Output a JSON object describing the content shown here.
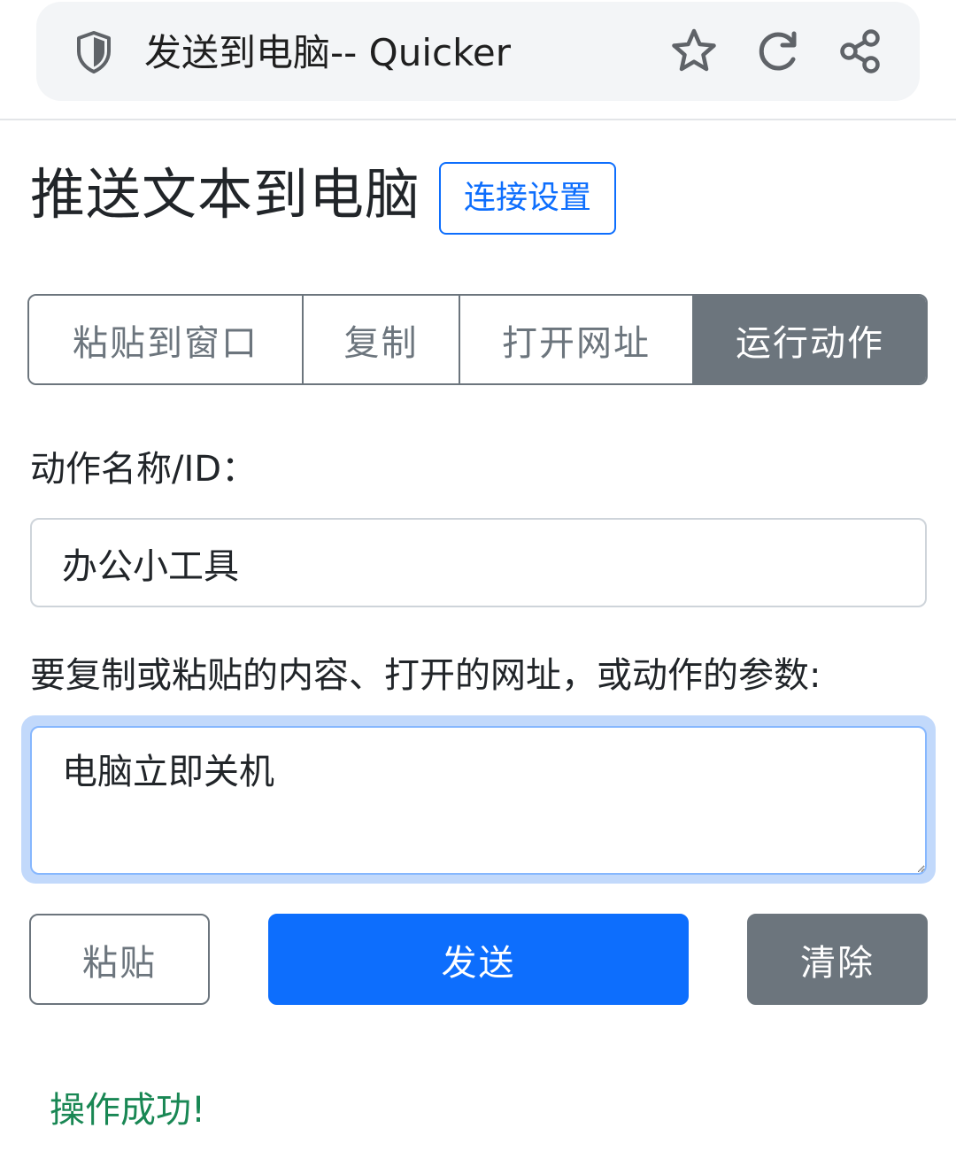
{
  "browser": {
    "page_title": "发送到电脑-- Quicker",
    "icons": [
      "shield-icon",
      "star-icon",
      "refresh-icon",
      "share-icon"
    ]
  },
  "header": {
    "title": "推送文本到电脑",
    "settings_label": "连接设置"
  },
  "modes": {
    "items": [
      {
        "label": "粘贴到窗口",
        "active": false
      },
      {
        "label": "复制",
        "active": false
      },
      {
        "label": "打开网址",
        "active": false
      },
      {
        "label": "运行动作",
        "active": true
      }
    ]
  },
  "form": {
    "action_label": "动作名称/ID：",
    "action_value": "办公小工具",
    "content_label": "要复制或粘贴的内容、打开的网址，或动作的参数:",
    "content_value": "电脑立即关机"
  },
  "actions": {
    "paste_label": "粘贴",
    "send_label": "发送",
    "clear_label": "清除"
  },
  "status": {
    "message": "操作成功!"
  },
  "colors": {
    "primary": "#0d6efd",
    "secondary": "#6c757d",
    "success": "#198754",
    "focus_ring": "#c2d9fb"
  }
}
